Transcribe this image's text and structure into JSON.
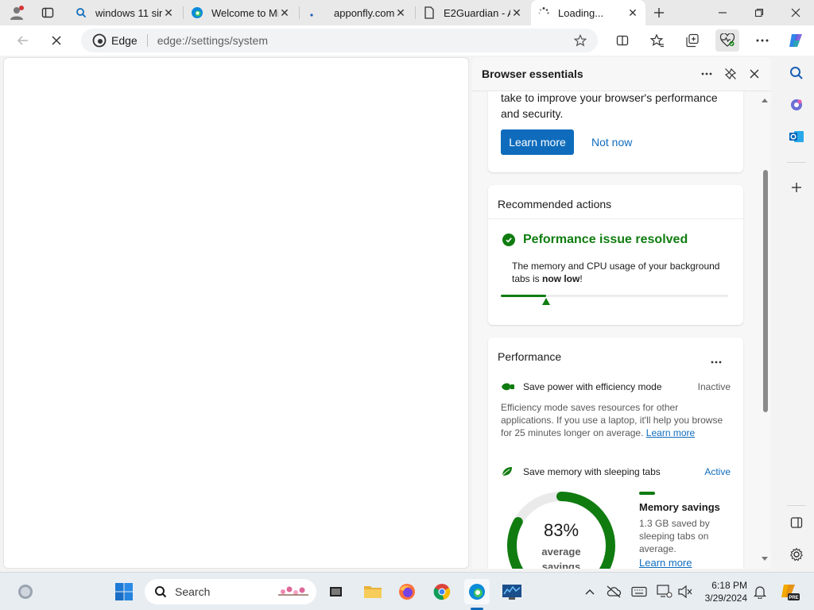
{
  "tabs": [
    {
      "title": "windows 11 sir",
      "favicon": "search-icon"
    },
    {
      "title": "Welcome to Mi",
      "favicon": "edge-logo-icon"
    },
    {
      "title": "apponfly.com",
      "favicon": "dot-icon"
    },
    {
      "title": "E2Guardian - A",
      "favicon": "document-icon"
    },
    {
      "title": "Loading...",
      "favicon": "loading-spinner-icon",
      "active": true
    }
  ],
  "toolbar": {
    "site_label": "Edge",
    "url": "edge://settings/system"
  },
  "panel": {
    "title": "Browser essentials",
    "intro_text": "take to improve your browser's performance and security.",
    "learn_more_button": "Learn more",
    "not_now_link": "Not now",
    "recommended": {
      "title": "Recommended actions",
      "status_title": "Peformance issue resolved",
      "desc_prefix": "The memory and CPU usage of your background tabs is ",
      "desc_bold": "now low",
      "desc_suffix": "!",
      "progress_fraction": 0.2
    },
    "performance": {
      "title": "Performance",
      "efficiency": {
        "label": "Save power with efficiency mode",
        "status": "Inactive",
        "desc": "Efficiency mode saves resources for other applications. If you use a laptop, it'll help you browse for 25 minutes longer on average.",
        "link": "Learn more"
      },
      "sleeping": {
        "label": "Save memory with sleeping tabs",
        "status": "Active"
      },
      "memory": {
        "percent_label": "83%",
        "percent_value": 83,
        "sub_line1": "average",
        "sub_line2": "savings",
        "title": "Memory savings",
        "desc": "1.3 GB saved by sleeping tabs on average.",
        "link": "Learn more"
      }
    }
  },
  "taskbar": {
    "search_label": "Search",
    "time": "6:18 PM",
    "date": "3/29/2024"
  },
  "colors": {
    "accent_blue": "#0f6cbd",
    "success_green": "#107c10"
  }
}
